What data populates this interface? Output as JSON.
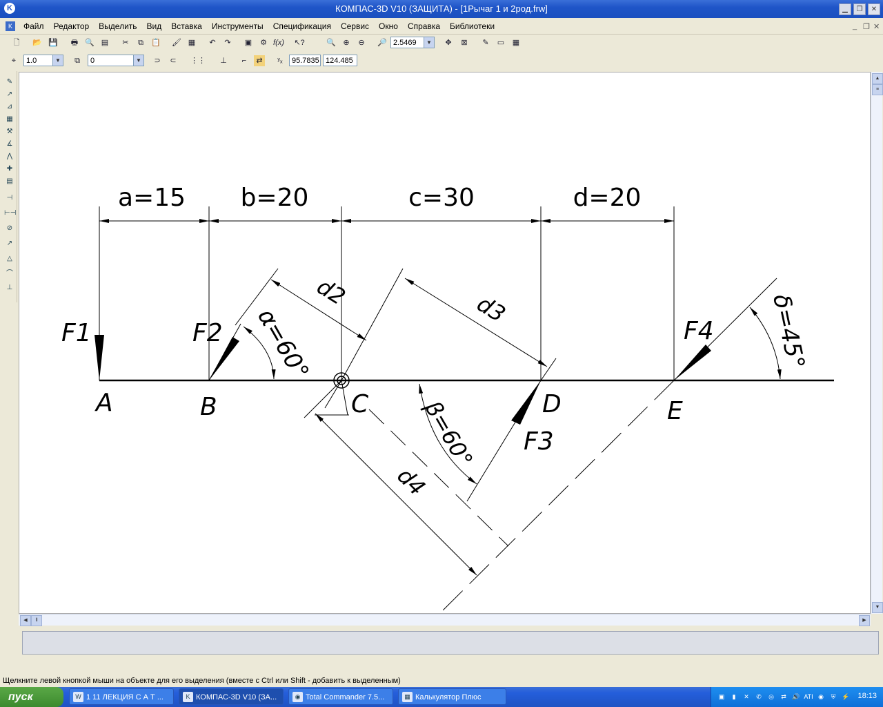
{
  "window": {
    "app_title": "КОМПАС-3D V10 (ЗАЩИТА) - ",
    "doc_title": "[1Рычаг 1  и 2род.frw]"
  },
  "menu": {
    "items": [
      "Файл",
      "Редактор",
      "Выделить",
      "Вид",
      "Вставка",
      "Инструменты",
      "Спецификация",
      "Сервис",
      "Окно",
      "Справка",
      "Библиотеки"
    ]
  },
  "toolbar": {
    "zoom_value": "2.5469",
    "style_value": "1.0",
    "layer_value": "0",
    "coord_x": "95.7835",
    "coord_y": "124.485"
  },
  "drawing": {
    "dim_a": "a=15",
    "dim_b": "b=20",
    "dim_c": "c=30",
    "dim_d": "d=20",
    "pt_A": "A",
    "pt_B": "B",
    "pt_C": "C",
    "pt_D": "D",
    "pt_E": "E",
    "f1": "F1",
    "f2": "F2",
    "f3": "F3",
    "f4": "F4",
    "alpha": "α=60°",
    "beta": "β=60°",
    "delta": "δ=45°",
    "d2": "d2",
    "d3": "d3",
    "d4": "d4"
  },
  "status": {
    "hint": "Щелкните левой кнопкой мыши на объекте для его выделения (вместе с Ctrl или Shift - добавить к выделенным)"
  },
  "taskbar": {
    "start_label": "пуск",
    "tasks": [
      "1 11 ЛЕКЦИЯ С А Т ...",
      "КОМПАС-3D V10 (ЗА...",
      "Total Commander 7.5...",
      "Калькулятор Плюс"
    ],
    "clock": "18:13"
  }
}
